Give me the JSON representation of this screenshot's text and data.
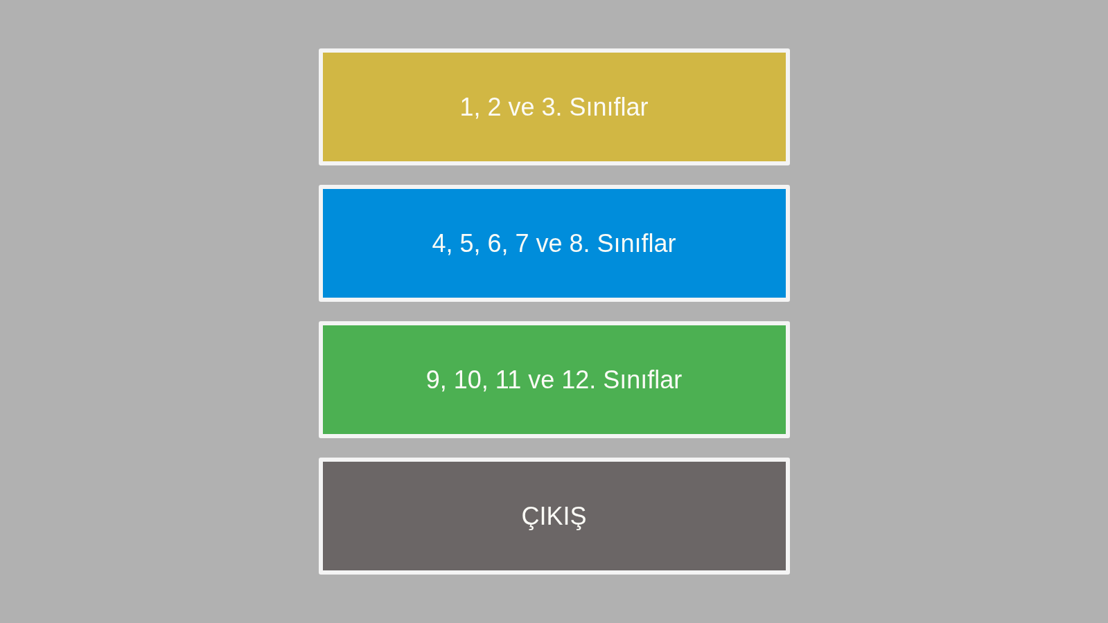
{
  "menu": {
    "buttons": [
      {
        "label": "1, 2 ve 3. Sınıflar",
        "color": "#d1b744"
      },
      {
        "label": "4, 5, 6, 7 ve 8. Sınıflar",
        "color": "#008ddb"
      },
      {
        "label": "9, 10, 11 ve 12. Sınıflar",
        "color": "#4cb052"
      },
      {
        "label": "ÇIKIŞ",
        "color": "#6b6666"
      }
    ]
  }
}
